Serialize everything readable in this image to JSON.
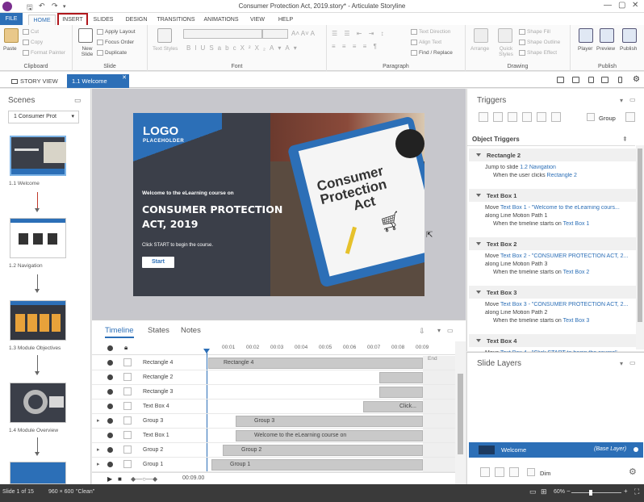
{
  "window": {
    "title": "Consumer Protection Act, 2019.story* - Articulate Storyline"
  },
  "ribbon_tabs": [
    "FILE",
    "HOME",
    "INSERT",
    "SLIDES",
    "DESIGN",
    "TRANSITIONS",
    "ANIMATIONS",
    "VIEW",
    "HELP"
  ],
  "ribbon": {
    "clipboard": {
      "paste": "Paste",
      "cut": "Cut",
      "copy": "Copy",
      "format_painter": "Format Painter",
      "label": "Clipboard"
    },
    "slide": {
      "new_slide": "New Slide",
      "apply_layout": "Apply Layout",
      "focus_order": "Focus Order",
      "duplicate": "Duplicate",
      "label": "Slide"
    },
    "font": {
      "text_styles": "Text Styles",
      "label": "Font"
    },
    "paragraph": {
      "text_direction": "Text Direction",
      "align_text": "Align Text",
      "find_replace": "Find / Replace",
      "label": "Paragraph"
    },
    "drawing": {
      "arrange": "Arrange",
      "quick_styles": "Quick Styles",
      "shape_fill": "Shape Fill",
      "shape_outline": "Shape Outline",
      "shape_effect": "Shape Effect",
      "label": "Drawing"
    },
    "publish": {
      "player": "Player",
      "preview": "Preview",
      "publish": "Publish",
      "label": "Publish"
    }
  },
  "doc_tabs": {
    "story_view": "STORY VIEW",
    "active": "1.1 Welcome"
  },
  "scenes": {
    "title": "Scenes",
    "selector": "1 Consumer Prot",
    "slides": [
      "1.1 Welcome",
      "1.2 Navigation",
      "1.3 Module Objectives",
      "1.4 Module Overview"
    ]
  },
  "slide": {
    "logo": "LOGO",
    "logo_sub": "PLACEHOLDER",
    "welcome": "Welcome to the eLearning course on",
    "course_title_1": "CONSUMER PROTECTION",
    "course_title_2": "ACT, 2019",
    "click_start": "Click START to begin the course.",
    "start_button": "Start",
    "clipboard_text_1": "Consumer",
    "clipboard_text_2": "Protection",
    "clipboard_text_3": "Act"
  },
  "timeline": {
    "tabs": [
      "Timeline",
      "States",
      "Notes"
    ],
    "ticks": [
      "00:01",
      "00:02",
      "00:03",
      "00:04",
      "00:05",
      "00:06",
      "00:07",
      "00:08",
      "00:09"
    ],
    "end_label": "End",
    "time_display": "00:09.00",
    "rows": [
      {
        "name": "Rectangle 4",
        "bar": "Rectangle 4"
      },
      {
        "name": "Rectangle 2",
        "bar": ""
      },
      {
        "name": "Rectangle 3",
        "bar": ""
      },
      {
        "name": "Text Box 4",
        "bar": "Click..."
      },
      {
        "name": "Group 3",
        "bar": "Group 3"
      },
      {
        "name": "Text Box 1",
        "bar": "Welcome to the eLearning course on"
      },
      {
        "name": "Group 2",
        "bar": "Group 2"
      },
      {
        "name": "Group 1",
        "bar": "Group 1"
      }
    ]
  },
  "triggers": {
    "title": "Triggers",
    "group_label": "Group",
    "object_triggers": "Object Triggers",
    "sections": [
      {
        "name": "Rectangle 2",
        "line1a": "Jump to slide ",
        "line1b": "1.2 Navigation",
        "line2a": "When the user clicks ",
        "line2b": "Rectangle 2"
      },
      {
        "name": "Text Box 1",
        "line1a": "Move ",
        "line1b": "Text Box 1 - \"Welcome to the eLearning cours...",
        "line1c": "along Line Motion Path 1",
        "line2a": "When the timeline starts on ",
        "line2b": "Text Box 1"
      },
      {
        "name": "Text Box 2",
        "line1a": "Move ",
        "line1b": "Text Box 2 - \"CONSUMER PROTECTION ACT, 2...",
        "line1c": "along Line Motion Path 3",
        "line2a": "When the timeline starts on ",
        "line2b": "Text Box 2"
      },
      {
        "name": "Text Box 3",
        "line1a": "Move ",
        "line1b": "Text Box 3 - \"CONSUMER PROTECTION ACT, 2...",
        "line1c": "along Line Motion Path 2",
        "line2a": "When the timeline starts on ",
        "line2b": "Text Box 3"
      },
      {
        "name": "Text Box 4",
        "line1a": "Move ",
        "line1b": "Text Box 4 - \"Click START to begin the course\"",
        "line1c": "",
        "line2a": "",
        "line2b": ""
      }
    ]
  },
  "slide_layers": {
    "title": "Slide Layers",
    "base": "Welcome",
    "base_tag": "(Base Layer)",
    "dim": "Dim"
  },
  "status": {
    "slide": "Slide 1 of 15",
    "size": "960 × 600",
    "theme": "\"Clean\"",
    "zoom": "60%"
  }
}
